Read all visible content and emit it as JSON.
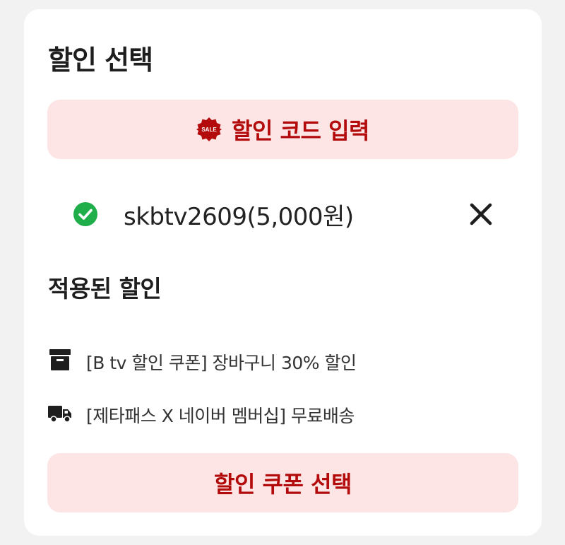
{
  "panel": {
    "title": "할인 선택"
  },
  "code_button": {
    "label": "할인 코드 입력",
    "icon": "sale-badge-icon",
    "icon_text": "SALE",
    "color": "#b30b0b",
    "background": "#fde5e5"
  },
  "applied_code": {
    "text": "skbtv2609(5,000원)",
    "status_icon": "check-circle-icon",
    "status_color": "#1fae4a",
    "remove_icon": "close-icon"
  },
  "applied_discounts": {
    "title": "적용된 할인",
    "items": [
      {
        "icon": "coupon-box-icon",
        "text": "[B tv 할인 쿠폰] 장바구니 30% 할인"
      },
      {
        "icon": "truck-icon",
        "text": "[제타패스 X 네이버 멤버십] 무료배송"
      }
    ]
  },
  "coupon_button": {
    "label": "할인 쿠폰 선택"
  }
}
